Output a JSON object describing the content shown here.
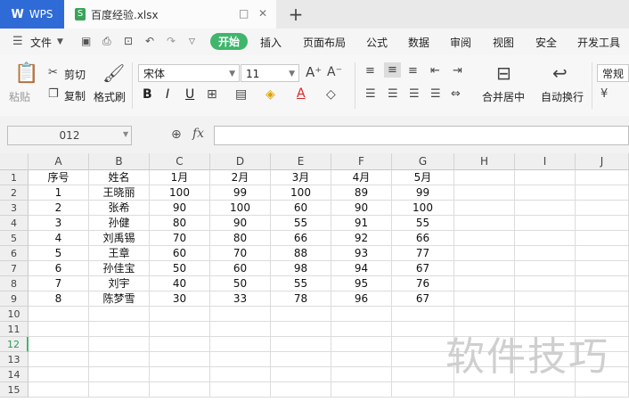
{
  "titlebar": {
    "app_name": "WPS",
    "file_name": "百度经验.xlsx",
    "controls": [
      "□",
      "✕"
    ],
    "new_tab": "+"
  },
  "menubar": {
    "file_menu": "文件",
    "items": [
      "开始",
      "插入",
      "页面布局",
      "公式",
      "数据",
      "审阅",
      "视图",
      "安全",
      "开发工具"
    ],
    "active_item": "开始"
  },
  "ribbon": {
    "paste": "粘贴",
    "cut": "剪切",
    "copy": "复制",
    "format_painter": "格式刷",
    "font_name": "宋体",
    "font_size": "11",
    "bold": "B",
    "italic": "I",
    "underline": "U",
    "merge_center": "合并居中",
    "wrap_text": "自动换行",
    "number_format": "常规"
  },
  "formulabar": {
    "name_box": "012",
    "fx_label": "fx",
    "value": ""
  },
  "sheet": {
    "columns": [
      "A",
      "B",
      "C",
      "D",
      "E",
      "F",
      "G",
      "H",
      "I",
      "J"
    ],
    "row_numbers": [
      "1",
      "2",
      "3",
      "4",
      "5",
      "6",
      "7",
      "8",
      "9",
      "10",
      "11",
      "12",
      "13",
      "14",
      "15"
    ],
    "selected_row": "12",
    "rows": [
      [
        "序号",
        "姓名",
        "1月",
        "2月",
        "3月",
        "4月",
        "5月"
      ],
      [
        "1",
        "王晓丽",
        "100",
        "99",
        "100",
        "89",
        "99"
      ],
      [
        "2",
        "张希",
        "90",
        "100",
        "60",
        "90",
        "100"
      ],
      [
        "3",
        "孙健",
        "80",
        "90",
        "55",
        "91",
        "55"
      ],
      [
        "4",
        "刘禹锡",
        "70",
        "80",
        "66",
        "92",
        "66"
      ],
      [
        "5",
        "王章",
        "60",
        "70",
        "88",
        "93",
        "77"
      ],
      [
        "6",
        "孙佳宝",
        "50",
        "60",
        "98",
        "94",
        "67"
      ],
      [
        "7",
        "刘宇",
        "40",
        "50",
        "55",
        "95",
        "76"
      ],
      [
        "8",
        "陈梦雪",
        "30",
        "33",
        "78",
        "96",
        "67"
      ]
    ]
  },
  "watermark": "软件技巧",
  "colors": {
    "accent_green": "#3fb66b",
    "wps_blue": "#2f6bd6"
  }
}
